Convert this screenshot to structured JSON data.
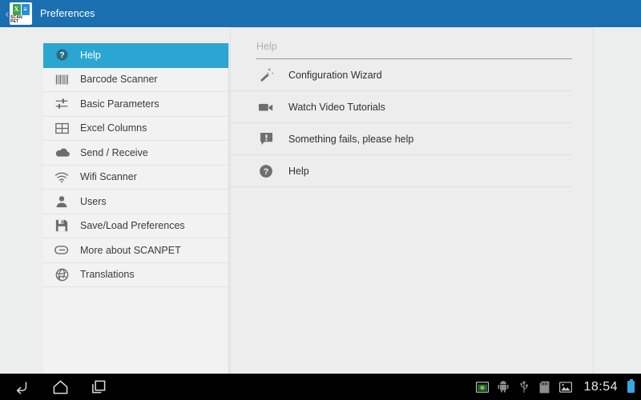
{
  "actionbar": {
    "back_caret": "‹",
    "title": "Preferences",
    "app_icon_caption": "SCAN PET",
    "app_icon_left_glyph": "X",
    "app_icon_right_glyph": "≡",
    "bar_color": "#1a6fb0"
  },
  "sidebar": {
    "selected_color": "#2ba6d3",
    "items": [
      {
        "label": "Help",
        "icon": "help-circle-icon",
        "selected": true
      },
      {
        "label": "Barcode Scanner",
        "icon": "barcode-icon",
        "selected": false
      },
      {
        "label": "Basic Parameters",
        "icon": "sliders-icon",
        "selected": false
      },
      {
        "label": "Excel Columns",
        "icon": "table-grid-icon",
        "selected": false
      },
      {
        "label": "Send / Receive",
        "icon": "cloud-icon",
        "selected": false
      },
      {
        "label": "Wifi Scanner",
        "icon": "wifi-icon",
        "selected": false
      },
      {
        "label": "Users",
        "icon": "person-icon",
        "selected": false
      },
      {
        "label": "Save/Load Preferences",
        "icon": "floppy-disk-icon",
        "selected": false
      },
      {
        "label": "More about SCANPET",
        "icon": "paperclip-icon",
        "selected": false
      },
      {
        "label": "Translations",
        "icon": "globe-icon",
        "selected": false
      }
    ]
  },
  "content": {
    "header": "Help",
    "items": [
      {
        "label": "Configuration Wizard",
        "icon": "magic-wand-icon"
      },
      {
        "label": "Watch Video Tutorials",
        "icon": "video-camera-icon"
      },
      {
        "label": "Something fails, please help",
        "icon": "message-alert-icon"
      },
      {
        "label": "Help",
        "icon": "help-circle-icon"
      }
    ]
  },
  "navbar": {
    "back_label": "Back",
    "home_label": "Home",
    "recents_label": "Recent apps",
    "status_icons": [
      "screenshot-icon",
      "android-robot-icon",
      "usb-icon",
      "sd-card-icon",
      "image-gallery-icon"
    ],
    "clock": "18:54",
    "battery_color": "#35a8dd"
  }
}
